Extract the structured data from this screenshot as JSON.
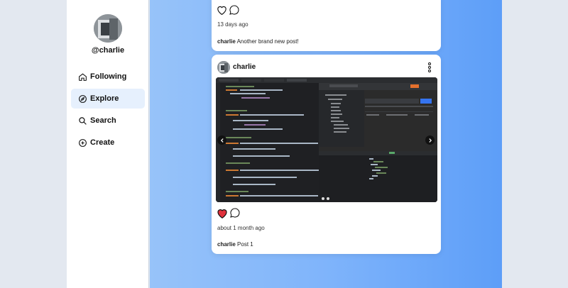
{
  "profile": {
    "username": "@charlie"
  },
  "nav": {
    "items": [
      {
        "label": "Following",
        "icon": "home-icon"
      },
      {
        "label": "Explore",
        "icon": "compass-icon",
        "active": true
      },
      {
        "label": "Search",
        "icon": "search-icon"
      },
      {
        "label": "Create",
        "icon": "plus-circle-icon"
      }
    ]
  },
  "posts": [
    {
      "author": "charlie",
      "timestamp": "13 days ago",
      "caption_user": "charlie",
      "caption_text": "Another brand new post!",
      "liked": false
    },
    {
      "author": "charlie",
      "timestamp": "about 1 month ago",
      "caption_user": "charlie",
      "caption_text": "Post 1",
      "liked": true,
      "carousel_dots": 2
    }
  ],
  "colors": {
    "accent_active_bg": "#e6f0fd",
    "like_red": "#e0313c",
    "feed_gradient_start": "#97c3f9",
    "feed_gradient_end": "#5d9ef8"
  }
}
